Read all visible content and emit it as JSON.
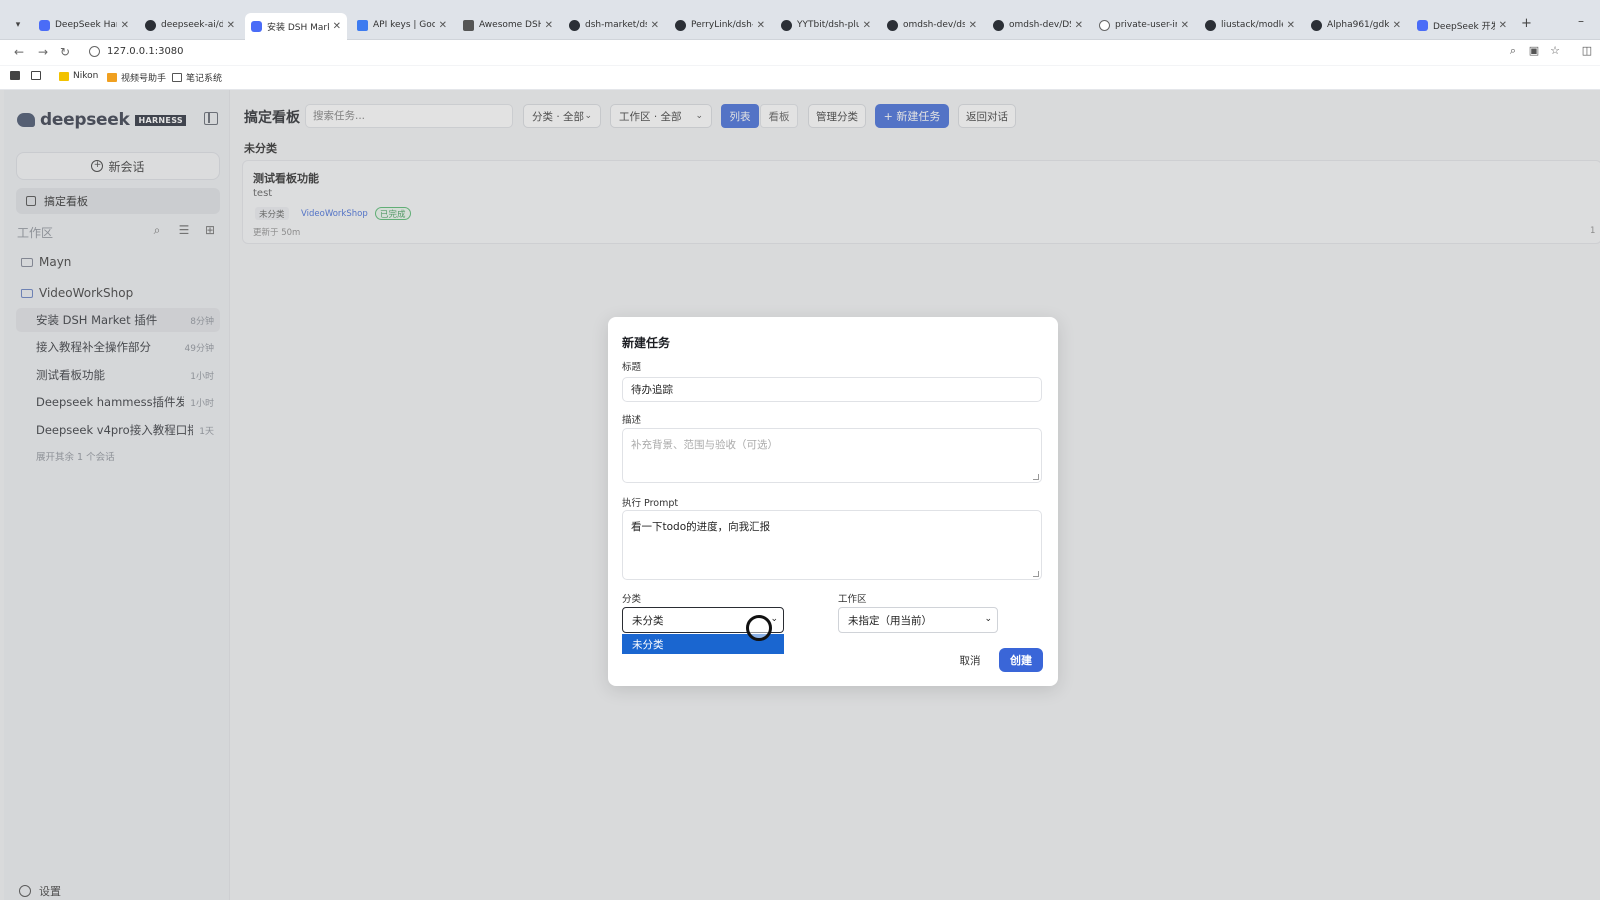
{
  "browser": {
    "tabs": [
      {
        "label": "DeepSeek Harn",
        "icon": "ds"
      },
      {
        "label": "deepseek-ai/dee",
        "icon": "gh"
      },
      {
        "label": "安装 DSH Marke",
        "icon": "ds"
      },
      {
        "label": "API keys | Googl",
        "icon": "g"
      },
      {
        "label": "Awesome DSH |",
        "icon": "d"
      },
      {
        "label": "dsh-market/dsh",
        "icon": "gh"
      },
      {
        "label": "PerryLink/dsh-c",
        "icon": "gh"
      },
      {
        "label": "YYTbit/dsh-plug",
        "icon": "gh"
      },
      {
        "label": "omdsh-dev/dsh",
        "icon": "gh"
      },
      {
        "label": "omdsh-dev/DS",
        "icon": "gh"
      },
      {
        "label": "private-user-im",
        "icon": "o"
      },
      {
        "label": "liustack/modler",
        "icon": "gh"
      },
      {
        "label": "Alpha961/gdkar",
        "icon": "gh"
      },
      {
        "label": "DeepSeek 开发",
        "icon": "ds"
      }
    ],
    "url": "127.0.0.1:3080",
    "bookmarks": [
      {
        "label": "Nikon"
      },
      {
        "label": "视频号助手"
      },
      {
        "label": "笔记系统"
      }
    ]
  },
  "sidebar": {
    "brand": "deepseek",
    "badge": "HARNESS",
    "new_chat": "新会话",
    "board": "搞定看板",
    "workspace_label": "工作区",
    "folders": [
      "Mayn",
      "VideoWorkShop"
    ],
    "sessions": [
      {
        "title": "安装 DSH Market 插件",
        "time": "8分钟"
      },
      {
        "title": "接入教程补全操作部分",
        "time": "49分钟"
      },
      {
        "title": "测试看板功能",
        "time": "1小时"
      },
      {
        "title": "Deepseek hammess插件发...",
        "time": "1小时"
      },
      {
        "title": "Deepseek v4pro接入教程口播...",
        "time": "1天"
      }
    ],
    "more": "展开其余 1 个会话",
    "settings": "设置"
  },
  "header": {
    "title": "搞定看板",
    "search_placeholder": "搜索任务...",
    "category_filter": "分类 · 全部",
    "workspace_filter": "工作区 · 全部",
    "view_list": "列表",
    "view_board": "看板",
    "manage_categories": "管理分类",
    "new_task": "+ 新建任务",
    "back": "返回对话"
  },
  "board": {
    "group": "未分类",
    "task": {
      "title": "测试看板功能",
      "desc": "test",
      "category": "未分类",
      "workspace": "VideoWorkShop",
      "status": "已完成",
      "updated": "更新于 50m",
      "edge": "1"
    }
  },
  "modal": {
    "title": "新建任务",
    "label_title": "标题",
    "title_value": "待办追踪",
    "label_desc": "描述",
    "desc_placeholder": "补充背景、范围与验收（可选）",
    "label_prompt": "执行 Prompt",
    "prompt_value": "看一下todo的进度，向我汇报",
    "label_category": "分类",
    "category_value": "未分类",
    "category_options": [
      "未分类"
    ],
    "label_workspace": "工作区",
    "workspace_value": "未指定（用当前）",
    "cancel": "取消",
    "create": "创建"
  }
}
